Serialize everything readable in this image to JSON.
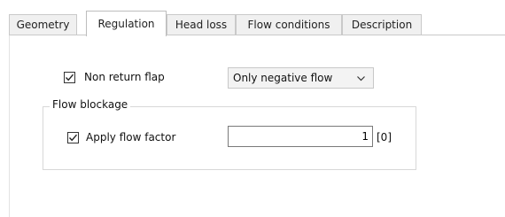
{
  "tabs": [
    {
      "label": "Geometry"
    },
    {
      "label": "Regulation"
    },
    {
      "label": "Head loss"
    },
    {
      "label": "Flow conditions"
    },
    {
      "label": "Description"
    }
  ],
  "active_tab": "Regulation",
  "regulation": {
    "non_return_flap": {
      "label": "Non return flap",
      "checked": true
    },
    "flow_direction": {
      "selected": "Only negative flow"
    }
  },
  "flow_blockage": {
    "title": "Flow blockage",
    "apply_flow_factor": {
      "label": "Apply flow factor",
      "checked": true
    },
    "flow_factor_value": "1",
    "unit": "[0]"
  },
  "icons": {
    "checkbox_check": "check-icon",
    "dropdown": "chevron-down-icon"
  }
}
